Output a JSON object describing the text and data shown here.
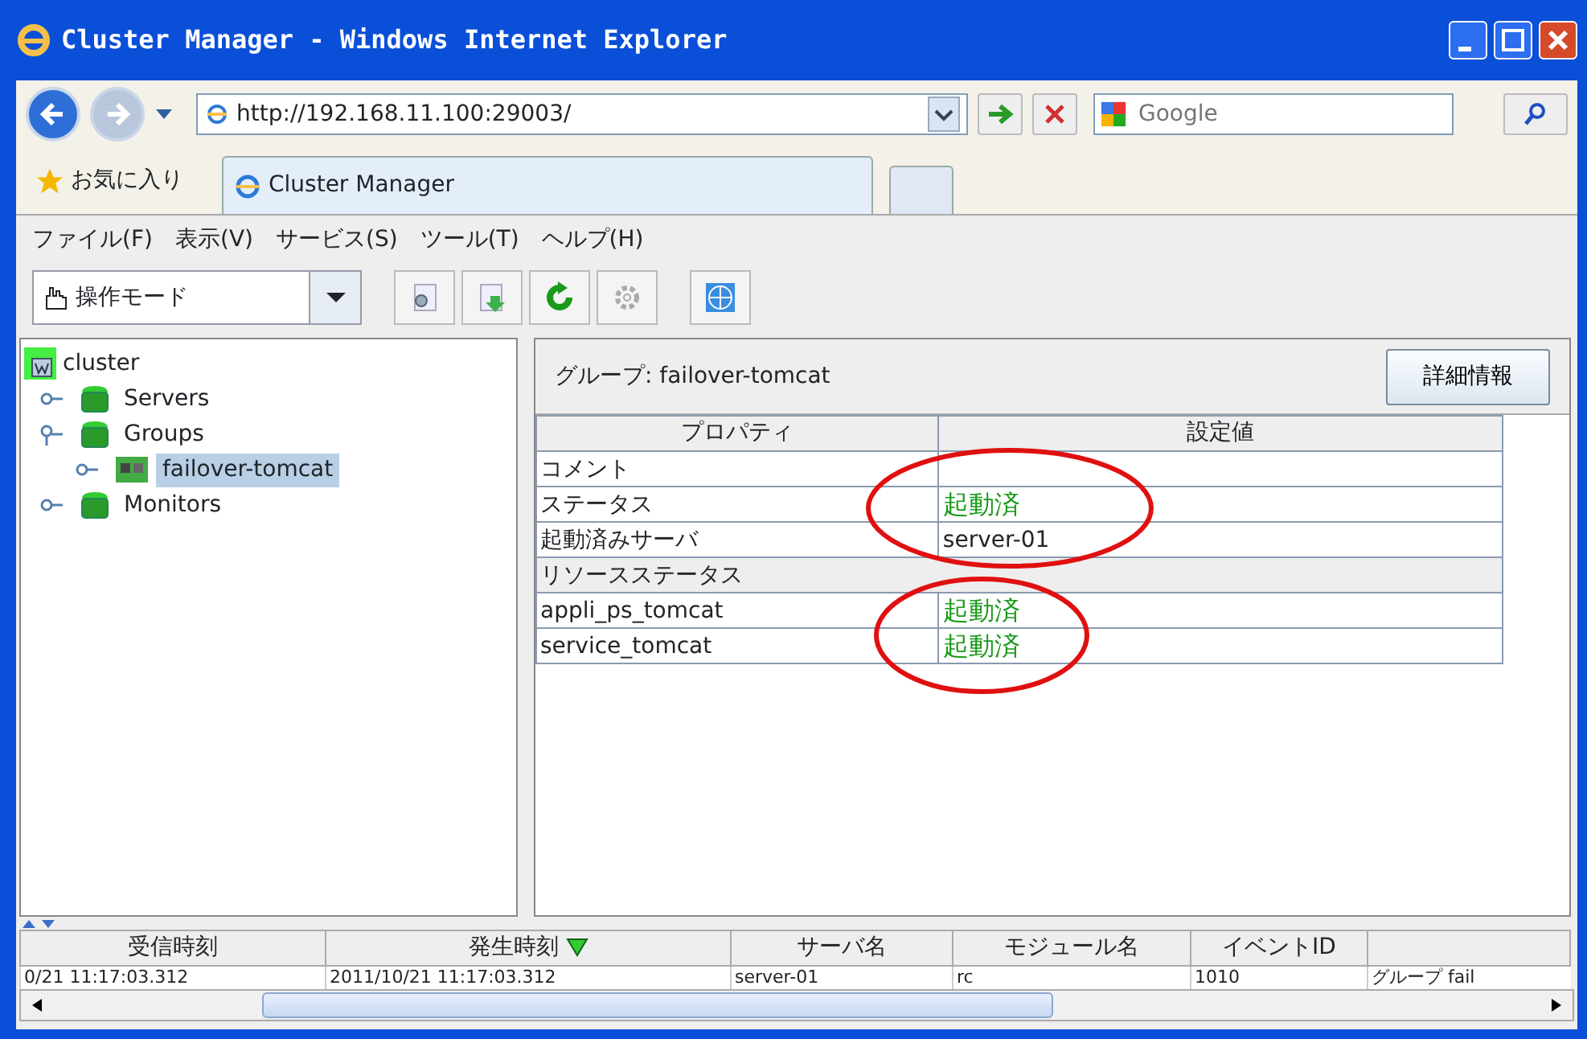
{
  "window": {
    "title": "Cluster Manager - Windows Internet Explorer"
  },
  "browser": {
    "url": "http://192.168.11.100:29003/",
    "search_placeholder": "Google",
    "favorites": "お気に入り",
    "tabs": [
      {
        "label": "Cluster Manager",
        "selected": true
      }
    ]
  },
  "menu": [
    "ファイル(F)",
    "表示(V)",
    "サービス(S)",
    "ツール(T)",
    "ヘルプ(H)"
  ],
  "toolbar": {
    "mode": "操作モード"
  },
  "tree": {
    "label": "cluster",
    "children": [
      {
        "label": "Servers",
        "expanded": false,
        "selected": false
      },
      {
        "label": "Groups",
        "expanded": true,
        "selected": false,
        "children": [
          {
            "label": "failover-tomcat",
            "expanded": false,
            "selected": true
          }
        ]
      },
      {
        "label": "Monitors",
        "expanded": false,
        "selected": false
      }
    ]
  },
  "detail": {
    "title": "グループ: failover-tomcat",
    "button": "詳細情報",
    "columns": [
      "プロパティ",
      "設定値"
    ],
    "rows": [
      {
        "kind": "row",
        "property": "コメント",
        "value": ""
      },
      {
        "kind": "row",
        "property": "ステータス",
        "value": "起動済",
        "status": true
      },
      {
        "kind": "row",
        "property": "起動済みサーバ",
        "value": "server-01",
        "status": false
      },
      {
        "kind": "section",
        "property": "リソースステータス"
      },
      {
        "kind": "row",
        "property": "appli_ps_tomcat",
        "value": "起動済",
        "status": true
      },
      {
        "kind": "row",
        "property": "service_tomcat",
        "value": "起動済",
        "status": true
      }
    ]
  },
  "annotations": [
    {
      "kind": "ellipse"
    },
    {
      "kind": "ellipse"
    }
  ],
  "log": {
    "columns": [
      {
        "label": "受信時刻",
        "sorted": false
      },
      {
        "label": "発生時刻",
        "sorted": true
      },
      {
        "label": "サーバ名",
        "sorted": false
      },
      {
        "label": "モジュール名",
        "sorted": false
      },
      {
        "label": "イベントID",
        "sorted": false
      }
    ],
    "rows": [
      [
        "0/21 11:17:03.312",
        "2011/10/21 11:17:03.312",
        "server-01",
        "rc",
        "1010",
        "グループ fail"
      ]
    ]
  }
}
